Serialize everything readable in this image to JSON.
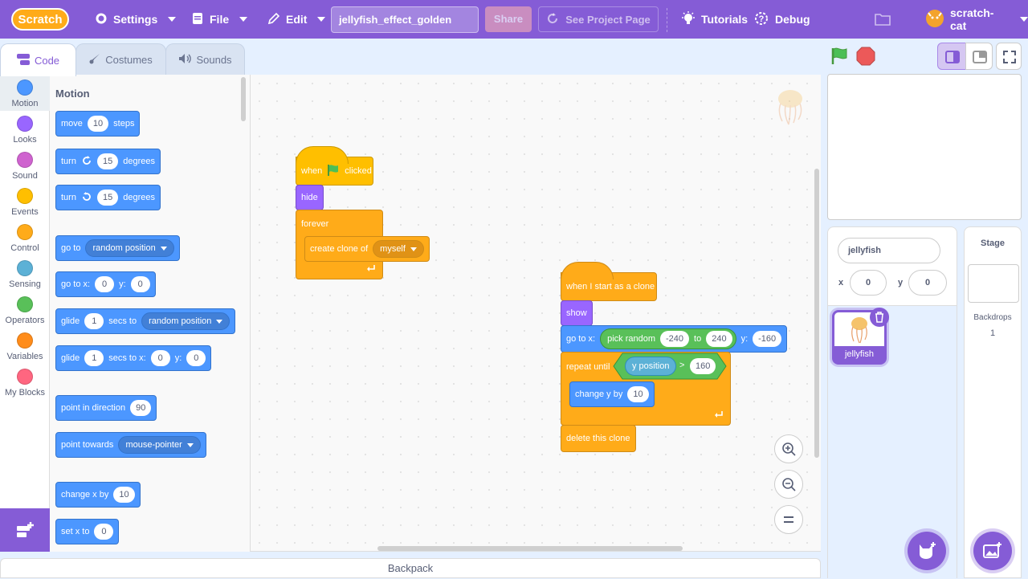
{
  "menu": {
    "logo": "Scratch",
    "settings": "Settings",
    "file": "File",
    "edit": "Edit",
    "project_title": "jellyfish_effect_golden",
    "share": "Share",
    "see_project": "See Project Page",
    "tutorials": "Tutorials",
    "debug": "Debug",
    "username": "scratch-cat"
  },
  "tabs": {
    "code": "Code",
    "costumes": "Costumes",
    "sounds": "Sounds"
  },
  "categories": [
    {
      "label": "Motion",
      "color": "#4c97ff"
    },
    {
      "label": "Looks",
      "color": "#9966ff"
    },
    {
      "label": "Sound",
      "color": "#cf63cf"
    },
    {
      "label": "Events",
      "color": "#ffbf00"
    },
    {
      "label": "Control",
      "color": "#ffab19"
    },
    {
      "label": "Sensing",
      "color": "#5cb1d6"
    },
    {
      "label": "Operators",
      "color": "#59c059"
    },
    {
      "label": "Variables",
      "color": "#ff8c1a"
    },
    {
      "label": "My Blocks",
      "color": "#ff6680"
    }
  ],
  "palette": {
    "heading": "Motion",
    "move": {
      "pre": "move",
      "val": "10",
      "post": "steps"
    },
    "turn_right": {
      "pre": "turn",
      "val": "15",
      "post": "degrees"
    },
    "turn_left": {
      "pre": "turn",
      "val": "15",
      "post": "degrees"
    },
    "goto": {
      "pre": "go to",
      "menu": "random position"
    },
    "goto_xy": {
      "pre": "go to x:",
      "x": "0",
      "ylab": "y:",
      "y": "0"
    },
    "glide_to": {
      "pre": "glide",
      "val": "1",
      "mid": "secs to",
      "menu": "random position"
    },
    "glide_xy": {
      "pre": "glide",
      "val": "1",
      "mid": "secs to x:",
      "x": "0",
      "ylab": "y:",
      "y": "0"
    },
    "point_dir": {
      "pre": "point in direction",
      "val": "90"
    },
    "point_towards": {
      "pre": "point towards",
      "menu": "mouse-pointer"
    },
    "change_x": {
      "pre": "change x by",
      "val": "10"
    },
    "set_x": {
      "pre": "set x to",
      "val": "0"
    }
  },
  "script1": {
    "when": "when",
    "clicked": "clicked",
    "hide": "hide",
    "forever": "forever",
    "create_clone": "create clone of",
    "clone_target": "myself"
  },
  "script2": {
    "hat": "when I start as a clone",
    "show": "show",
    "goto_x": "go to x:",
    "pick_random": "pick random",
    "from": "-240",
    "to_lab": "to",
    "to": "240",
    "y_lab": "y:",
    "y": "-160",
    "repeat_until": "repeat until",
    "y_position": "y position",
    "gt": ">",
    "limit": "160",
    "change_y": "change y by",
    "change_val": "10",
    "delete_clone": "delete this clone"
  },
  "backpack": "Backpack",
  "sprite_info": {
    "name": "jellyfish",
    "x_label": "x",
    "x": "0",
    "y_label": "y",
    "y": "0"
  },
  "sprites": [
    {
      "name": "jellyfish"
    }
  ],
  "stage_panel": {
    "title": "Stage",
    "backdrops_label": "Backdrops",
    "backdrops_count": "1"
  }
}
